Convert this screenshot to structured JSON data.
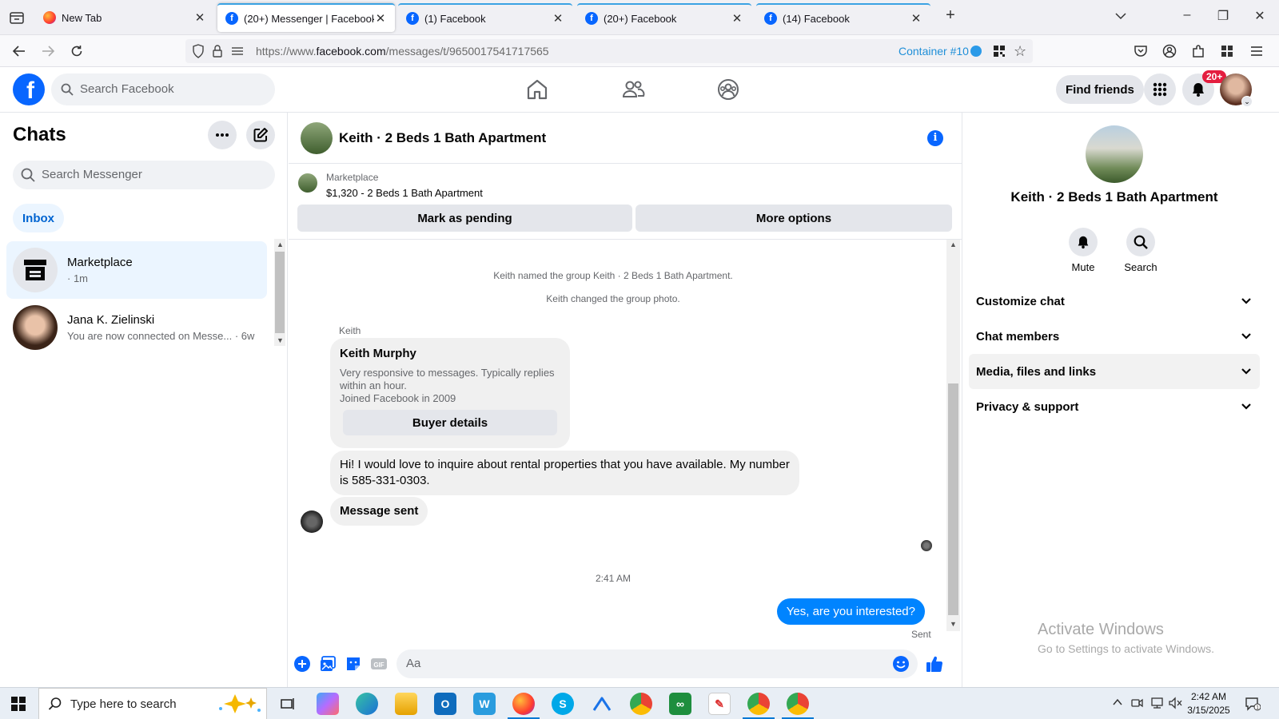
{
  "browser": {
    "tabs": [
      {
        "label": "New Tab",
        "favicon": "firefox-icon"
      },
      {
        "label": "(20+) Messenger | Facebook",
        "favicon": "facebook-icon"
      },
      {
        "label": "(1) Facebook",
        "favicon": "facebook-icon"
      },
      {
        "label": "(20+) Facebook",
        "favicon": "facebook-icon"
      },
      {
        "label": "(14) Facebook",
        "favicon": "facebook-icon"
      }
    ],
    "active_tab_index": 1,
    "url_prefix": "https://www.",
    "url_domain": "facebook.com",
    "url_path": "/messages/t/9650017541717565",
    "container_label": "Container #10",
    "container_color": "#2b9ae8"
  },
  "fb_header": {
    "search_placeholder": "Search Facebook",
    "find_friends_label": "Find friends",
    "notification_badge": "20+",
    "brand_color": "#0866ff"
  },
  "sidebar": {
    "title": "Chats",
    "search_placeholder": "Search Messenger",
    "filter_label": "Inbox",
    "conversations": [
      {
        "name": "Marketplace",
        "subtitle": "· 1m",
        "selected": true
      },
      {
        "name": "Jana K. Zielinski",
        "subtitle": "You are now connected on Messe... · 6w",
        "selected": false
      }
    ]
  },
  "conversation": {
    "title": "Keith · 2 Beds 1 Bath Apartment",
    "marketplace_label": "Marketplace",
    "listing": "$1,320 - 2 Beds 1 Bath Apartment",
    "mark_pending_label": "Mark as pending",
    "more_options_label": "More options",
    "system_messages": [
      "Keith named the group Keith · 2 Beds 1 Bath Apartment.",
      "Keith changed the group photo."
    ],
    "sender_name": "Keith",
    "buyer_card": {
      "name": "Keith Murphy",
      "description": "Very responsive to messages. Typically replies within an hour.",
      "joined": "Joined Facebook in 2009",
      "button_label": "Buyer details"
    },
    "incoming_message": "Hi! I would love to inquire about rental properties that you have available. My number is 585-331-0303.",
    "message_sent_label": "Message sent",
    "timestamp": "2:41 AM",
    "outgoing_message": "Yes, are you interested?",
    "outgoing_status": "Sent",
    "composer_placeholder": "Aa",
    "outgoing_color": "#0084ff"
  },
  "details_panel": {
    "title": "Keith · 2 Beds 1 Bath Apartment",
    "actions": [
      {
        "label": "Mute",
        "icon": "bell-icon"
      },
      {
        "label": "Search",
        "icon": "search-icon"
      }
    ],
    "sections": [
      {
        "label": "Customize chat",
        "highlighted": false
      },
      {
        "label": "Chat members",
        "highlighted": false
      },
      {
        "label": "Media, files and links",
        "highlighted": true
      },
      {
        "label": "Privacy & support",
        "highlighted": false
      }
    ]
  },
  "watermark": {
    "line1": "Activate Windows",
    "line2": "Go to Settings to activate Windows."
  },
  "taskbar": {
    "search_placeholder": "Type here to search",
    "time": "2:42 AM",
    "date": "3/15/2025"
  }
}
